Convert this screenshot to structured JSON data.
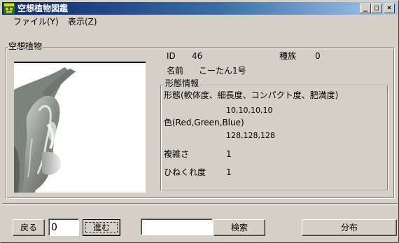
{
  "window": {
    "title": "空想植物図鑑",
    "controls": {
      "minimize": "_",
      "maximize": "□",
      "close": "×"
    }
  },
  "menu": [
    {
      "label": "ファイル(Y)"
    },
    {
      "label": "表示(Z)"
    }
  ],
  "plant_group": {
    "label": "空想植物",
    "id_label": "ID",
    "id_value": "46",
    "species_label": "種族",
    "species_value": "0",
    "name_label": "名前",
    "name_value": "こーたん1号"
  },
  "morphology": {
    "label": "形態情報",
    "form_label": "形態(軟体度、細長度、コンパクト度、肥満度)",
    "form_value": "10,10,10,10",
    "color_label": "色(Red,Green,Blue)",
    "color_value": "128,128,128",
    "complexity_label": "複雑さ",
    "complexity_value": "1",
    "twist_label": "ひねくれ度",
    "twist_value": "1"
  },
  "footer": {
    "back_label": "戻る",
    "page_value": "0",
    "forward_label": "進む",
    "search_value": "",
    "search_label": "検索",
    "distribution_label": "分布"
  },
  "colors": {
    "title_gradient_start": "#0a246a",
    "title_gradient_end": "#a6caf0",
    "face": "#d4d0c8",
    "plant_gray": "#808080"
  }
}
